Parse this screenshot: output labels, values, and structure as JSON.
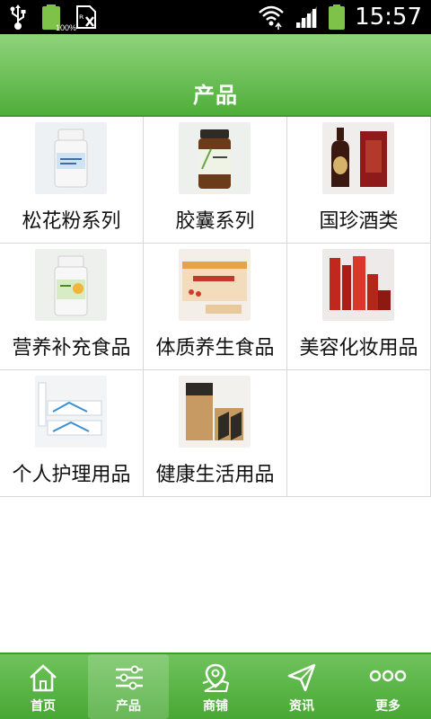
{
  "status_bar": {
    "battery_percent": "100%",
    "time": "15:57"
  },
  "header": {
    "title": "产品"
  },
  "products": [
    {
      "label": "松花粉系列",
      "icon": "pine-pollen-bottle-image"
    },
    {
      "label": "胶囊系列",
      "icon": "capsule-jar-image"
    },
    {
      "label": "国珍酒类",
      "icon": "wine-bottle-image"
    },
    {
      "label": "营养补充食品",
      "icon": "nutrition-bottle-image"
    },
    {
      "label": "体质养生食品",
      "icon": "wolfberry-box-image"
    },
    {
      "label": "美容化妆用品",
      "icon": "cosmetics-set-image"
    },
    {
      "label": "个人护理用品",
      "icon": "personal-care-tubes-image"
    },
    {
      "label": "健康生活用品",
      "icon": "health-product-box-image"
    }
  ],
  "bottom_nav": {
    "items": [
      {
        "label": "首页",
        "icon": "home-icon"
      },
      {
        "label": "产品",
        "icon": "sliders-icon",
        "active": true
      },
      {
        "label": "商铺",
        "icon": "map-icon"
      },
      {
        "label": "资讯",
        "icon": "send-icon"
      },
      {
        "label": "更多",
        "icon": "more-dots-icon"
      }
    ]
  },
  "colors": {
    "header_green": "#4fae3a",
    "nav_green": "#48a834",
    "divider": "#d7d7d7"
  }
}
